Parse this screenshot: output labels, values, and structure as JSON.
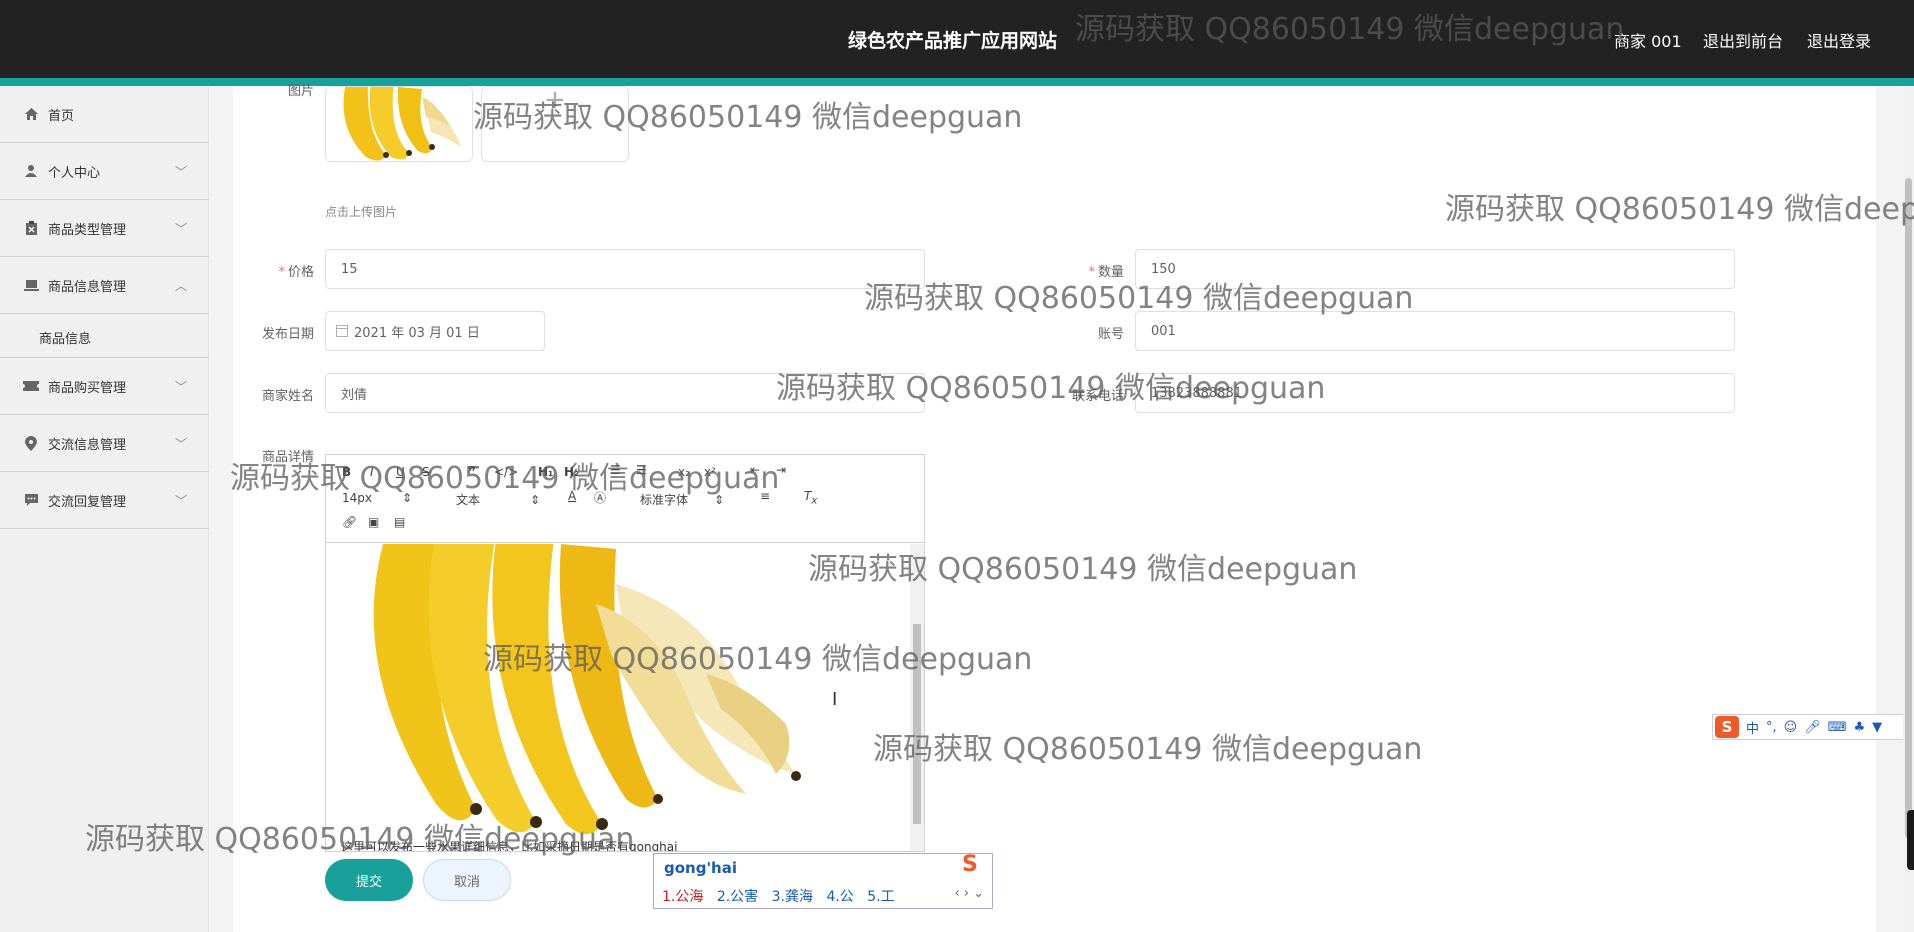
{
  "header": {
    "title": "绿色农产品推广应用网站",
    "user": "商家 001",
    "to_front": "退出到前台",
    "logout": "退出登录"
  },
  "sidebar": {
    "items": [
      {
        "label": "首页",
        "icon": "home-icon"
      },
      {
        "label": "个人中心",
        "icon": "user-icon"
      },
      {
        "label": "商品类型管理",
        "icon": "clipboard-icon"
      },
      {
        "label": "商品信息管理",
        "icon": "laptop-icon"
      },
      {
        "label": "商品购买管理",
        "icon": "ticket-icon"
      },
      {
        "label": "交流信息管理",
        "icon": "location-icon"
      },
      {
        "label": "交流回复管理",
        "icon": "chat-icon"
      }
    ],
    "sub_item": "商品信息"
  },
  "form": {
    "image_label": "图片",
    "upload_tip": "点击上传图片",
    "price_label": "价格",
    "price_value": "15",
    "qty_label": "数量",
    "qty_value": "150",
    "date_label": "发布日期",
    "date_value": "2021 年 03 月 01 日",
    "account_label": "账号",
    "account_value": "001",
    "merchant_label": "商家姓名",
    "merchant_value": "刘倩",
    "phone_label": "联系电话",
    "phone_value": "13823888881",
    "detail_label": "商品详情",
    "required_mark": "*"
  },
  "editor": {
    "font_size": "14px",
    "format": "文本",
    "font_family": "标准字体",
    "content_text": "这里可以发布一些水果详细信息，比如采摘日期是否有gonghai"
  },
  "buttons": {
    "submit": "提交",
    "cancel": "取消"
  },
  "ime": {
    "input": "gong'hai",
    "candidates": [
      "1.公海",
      "2.公害",
      "3.龚海",
      "4.公",
      "5.工"
    ]
  },
  "watermark": "源码获取 QQ86050149 微信deepguan",
  "colors": {
    "header_bg": "#222222",
    "accent": "#18a09a",
    "required": "#f56c6c"
  }
}
